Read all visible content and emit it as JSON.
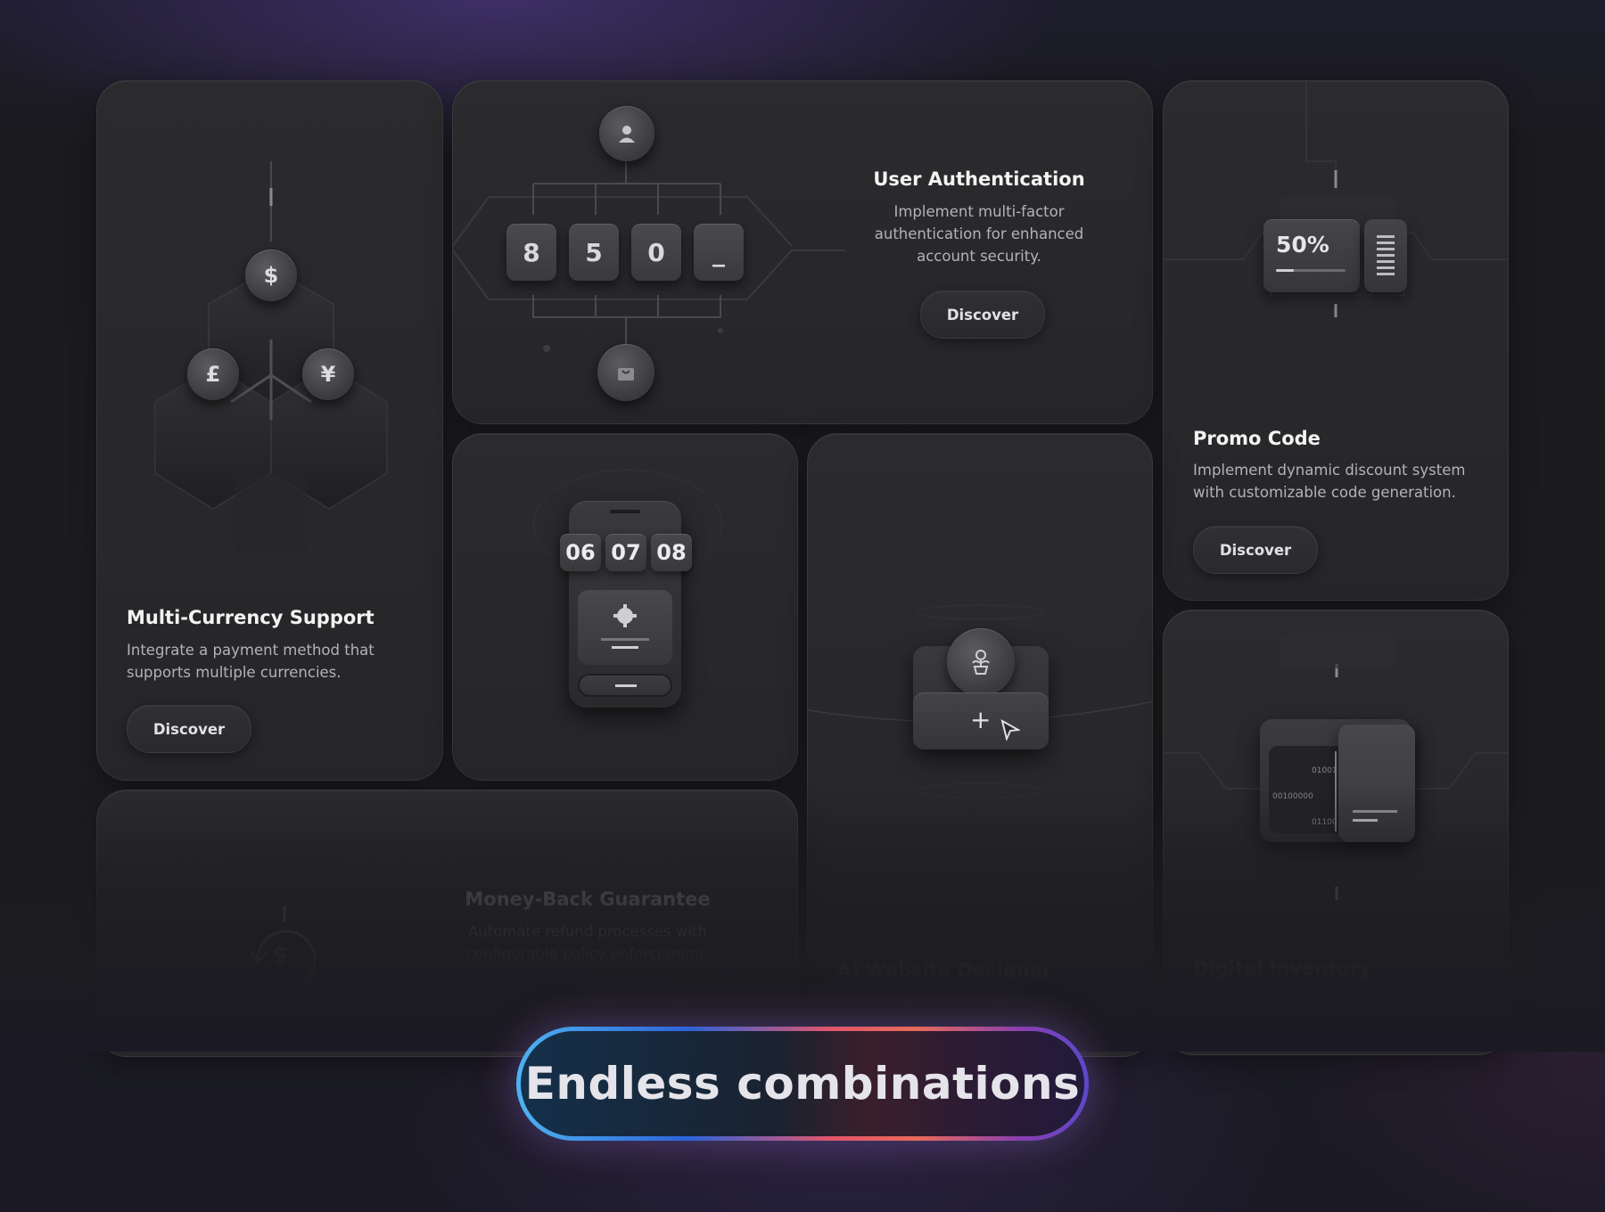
{
  "cards": {
    "multi_currency": {
      "title": "Multi-Currency Support",
      "description": "Integrate a payment method that supports multiple currencies.",
      "button": "Discover",
      "symbols": [
        "$",
        "£",
        "¥"
      ]
    },
    "user_auth": {
      "title": "User Authentication",
      "description": "Implement multi-factor authentication for enhanced account security.",
      "button": "Discover",
      "code_digits": [
        "8",
        "5",
        "0",
        "_"
      ]
    },
    "promo_code": {
      "title": "Promo Code",
      "description": "Implement dynamic discount system with customizable code generation.",
      "button": "Discover",
      "discount": "50%"
    },
    "timer": {
      "times": [
        "06",
        "07",
        "08"
      ]
    },
    "money_back": {
      "title": "Money-Back Guarantee",
      "description": "Automate refund processes with configurable policy enforcement.",
      "symbol": "$"
    },
    "ai_designer": {
      "title": "AI Website Designer"
    },
    "digital_inventory": {
      "title": "Digital Inventory",
      "binary": [
        "01001",
        "00100000",
        "01100"
      ]
    }
  },
  "banner": {
    "label": "Endless combinations"
  },
  "colors": {
    "pill_gradient": [
      "#4fb2f0",
      "#2c63d9",
      "#e2566a",
      "#8a3fb0",
      "#5b48c9"
    ],
    "card_bg": "#2a2a2d",
    "page_bg": "#1c1c1f"
  }
}
